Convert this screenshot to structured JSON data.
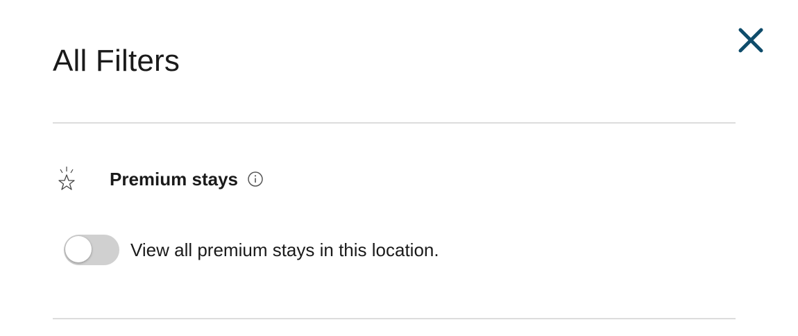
{
  "dialog": {
    "title": "All Filters",
    "close_icon": "close-icon",
    "close_color": "#0f4c6b"
  },
  "premium_section": {
    "icon": "sparkle-star-icon",
    "title": "Premium stays",
    "info_icon": "info-icon",
    "toggle": {
      "state": "off",
      "label": "View all premium stays in this location."
    }
  }
}
